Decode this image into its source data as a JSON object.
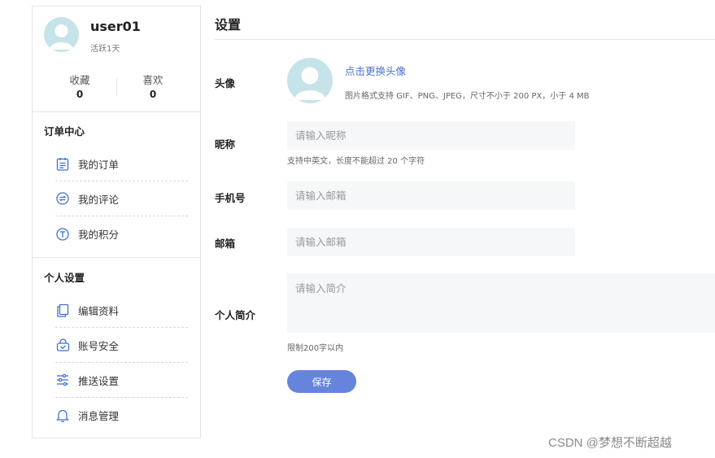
{
  "sidebar": {
    "profile": {
      "username": "user01",
      "active_days": "活跃1天",
      "stats": [
        {
          "label": "收藏",
          "value": "0"
        },
        {
          "label": "喜欢",
          "value": "0"
        }
      ]
    },
    "order_center": {
      "title": "订单中心",
      "items": [
        {
          "label": "我的订单",
          "icon": "order-list-icon"
        },
        {
          "label": "我的评论",
          "icon": "comment-icon"
        },
        {
          "label": "我的积分",
          "icon": "points-icon"
        }
      ]
    },
    "personal_settings": {
      "title": "个人设置",
      "items": [
        {
          "label": "编辑资料",
          "icon": "edit-profile-icon"
        },
        {
          "label": "账号安全",
          "icon": "security-icon"
        },
        {
          "label": "推送设置",
          "icon": "sliders-icon"
        },
        {
          "label": "消息管理",
          "icon": "bell-icon"
        }
      ]
    }
  },
  "main": {
    "title": "设置",
    "avatar": {
      "label": "头像",
      "change_link": "点击更换头像",
      "hint": "图片格式支持 GIF、PNG、JPEG，尺寸不小于 200 PX，小于 4 MB"
    },
    "nickname": {
      "label": "昵称",
      "placeholder": "请输入昵称",
      "value": "",
      "help": "支持中英文，长度不能超过 20 个字符"
    },
    "phone": {
      "label": "手机号",
      "placeholder": "请输入邮箱",
      "value": ""
    },
    "email": {
      "label": "邮箱",
      "placeholder": "请输入邮箱",
      "value": ""
    },
    "bio": {
      "label": "个人简介",
      "placeholder": "请输入简介",
      "value": "",
      "help": "限制200字以内"
    },
    "save_label": "保存"
  },
  "watermark": "CSDN @梦想不断超越",
  "colors": {
    "accent": "#6684dc",
    "link": "#4a72d1",
    "avatar_bg": "#c6e3ea",
    "icon": "#3f6fd6",
    "input_bg": "#f5f7f8"
  }
}
